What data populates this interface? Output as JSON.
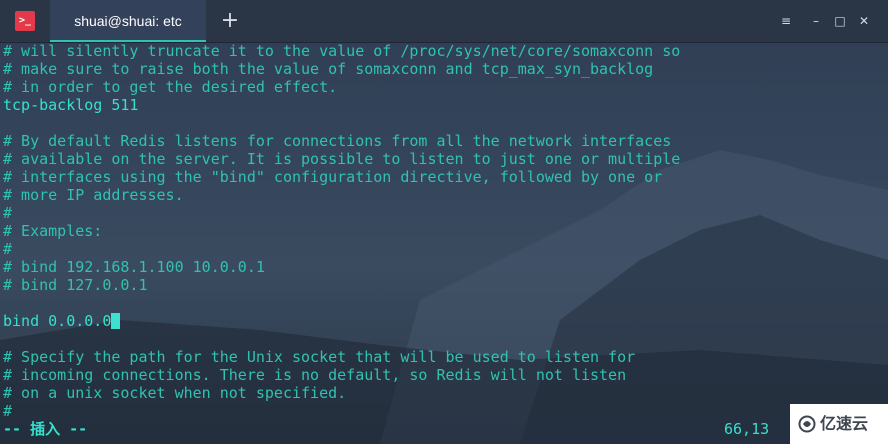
{
  "window": {
    "tab_title": "shuai@shuai: etc",
    "new_tab_symbol": "+",
    "buttons": {
      "menu": "≡",
      "minimize": "–",
      "maximize": "□",
      "close": "✕"
    }
  },
  "colors": {
    "comment_text": "#30c2b0",
    "code_text": "#36e0cf",
    "tab_accent": "#2ec3b6",
    "app_icon": "#e23a4a"
  },
  "editor": {
    "lines": [
      "# will silently truncate it to the value of /proc/sys/net/core/somaxconn so",
      "# make sure to raise both the value of somaxconn and tcp_max_syn_backlog",
      "# in order to get the desired effect.",
      "tcp-backlog 511",
      "",
      "# By default Redis listens for connections from all the network interfaces",
      "# available on the server. It is possible to listen to just one or multiple",
      "# interfaces using the \"bind\" configuration directive, followed by one or",
      "# more IP addresses.",
      "#",
      "# Examples:",
      "#",
      "# bind 192.168.1.100 10.0.0.1",
      "# bind 127.0.0.1",
      "",
      "bind 0.0.0.0",
      "",
      "# Specify the path for the Unix socket that will be used to listen for",
      "# incoming connections. There is no default, so Redis will not listen",
      "# on a unix socket when not specified.",
      "#"
    ],
    "mode": "-- 插入 --",
    "cursor_position": "66,13"
  },
  "watermark": {
    "text": "亿速云"
  }
}
